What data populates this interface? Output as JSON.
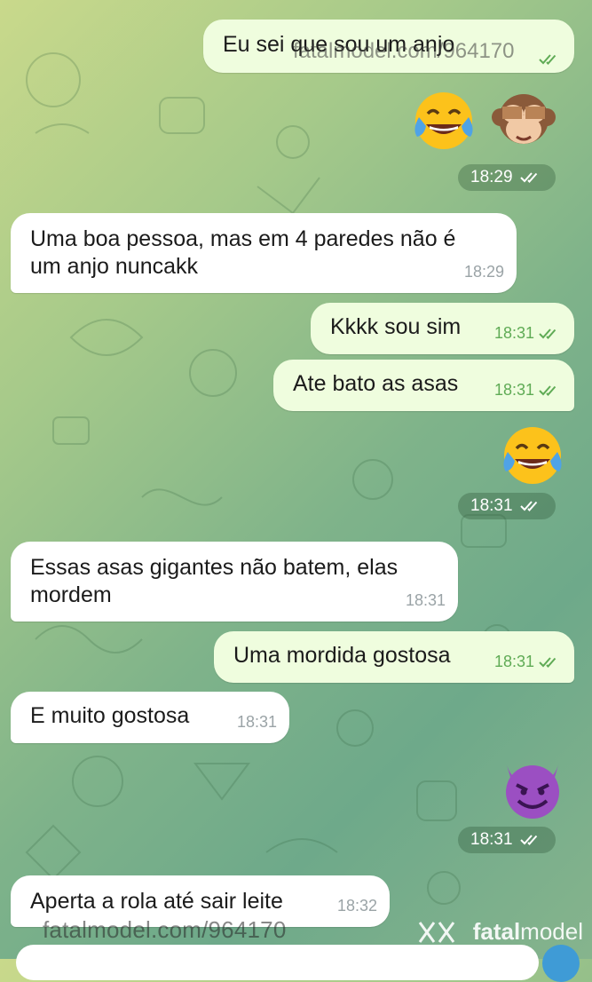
{
  "messages": [
    {
      "id": "m1",
      "side": "out",
      "text": "Eu sei que sou um anjo",
      "time": ""
    },
    {
      "id": "m2",
      "side": "emoji",
      "emojis": [
        "face-with-tears-of-joy",
        "see-no-evil-monkey"
      ],
      "time": "18:29"
    },
    {
      "id": "m3",
      "side": "in",
      "line1": "Uma boa pessoa, mas em 4 paredes não é",
      "line2": "um anjo nuncakk",
      "time": "18:29"
    },
    {
      "id": "m4",
      "side": "out",
      "text": "Kkkk sou sim",
      "time": "18:31"
    },
    {
      "id": "m5",
      "side": "out",
      "text": "Ate bato as asas",
      "time": "18:31"
    },
    {
      "id": "m6",
      "side": "emoji",
      "emojis": [
        "face-with-tears-of-joy"
      ],
      "time": "18:31"
    },
    {
      "id": "m7",
      "side": "in",
      "line1": "Essas asas gigantes não batem, elas",
      "line2": "mordem",
      "time": "18:31"
    },
    {
      "id": "m8",
      "side": "out",
      "text": "Uma mordida gostosa",
      "time": "18:31"
    },
    {
      "id": "m9",
      "side": "in",
      "text": "E muito gostosa",
      "time": "18:31"
    },
    {
      "id": "m10",
      "side": "emoji",
      "emojis": [
        "smiling-face-with-horns"
      ],
      "time": "18:31"
    },
    {
      "id": "m11",
      "side": "in",
      "text": "Aperta a rola até sair leite",
      "time": "18:32"
    }
  ],
  "watermark": {
    "url": "fatalmodel.com/964170",
    "brand_bold": "fatal",
    "brand_rest": "model"
  },
  "colors": {
    "outgoing_bubble": "#effdde",
    "incoming_bubble": "#ffffff",
    "read_check": "#5fab55",
    "send_button": "#3f9bd6"
  }
}
